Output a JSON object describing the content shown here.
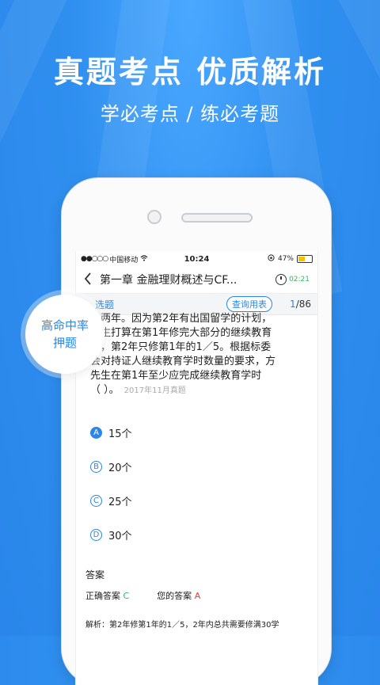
{
  "colors": {
    "accent": "#2a86ea",
    "correct": "#2ab36b",
    "wrong": "#e53935"
  },
  "promo": {
    "headline": "真题考点  优质解析",
    "subline": "学必考点 / 练必考题",
    "badge_line1": "高命中率",
    "badge_line2": "押题"
  },
  "status": {
    "carrier": "中国移动",
    "signal_dots": "●●○○○",
    "wifi_icon": "wifi-icon",
    "time": "10:24",
    "battery": "47%"
  },
  "nav": {
    "title": "第一章 金融理财概述与CF...",
    "timer": "02:21"
  },
  "tabs": {
    "question_type": "选题",
    "lookup_label": "查询用表",
    "current_page": "1",
    "total_pages": "/86"
  },
  "question": {
    "lines": [
      "为两年。因为第2年有出国留学的计划，",
      "先生打算在第1年修完大部分的继续教育",
      "时，第2年只修第1年的1／5。根据标委",
      "会对持证人继续教育学时数量的要求，方",
      "先生在第1年至少应完成继续教育学时"
    ],
    "last_line": "（ ）。",
    "source": "2017年11月真题"
  },
  "options": [
    {
      "letter": "A",
      "text": "15个"
    },
    {
      "letter": "B",
      "text": "20个"
    },
    {
      "letter": "C",
      "text": "25个"
    },
    {
      "letter": "D",
      "text": "30个"
    }
  ],
  "answer": {
    "heading": "答案",
    "correct_label": "正确答案",
    "correct_value": "C",
    "yours_label": "您的答案",
    "yours_value": "A",
    "analysis": "解析：第2年修第1年的1／5，2年内总共需要修满30学"
  }
}
